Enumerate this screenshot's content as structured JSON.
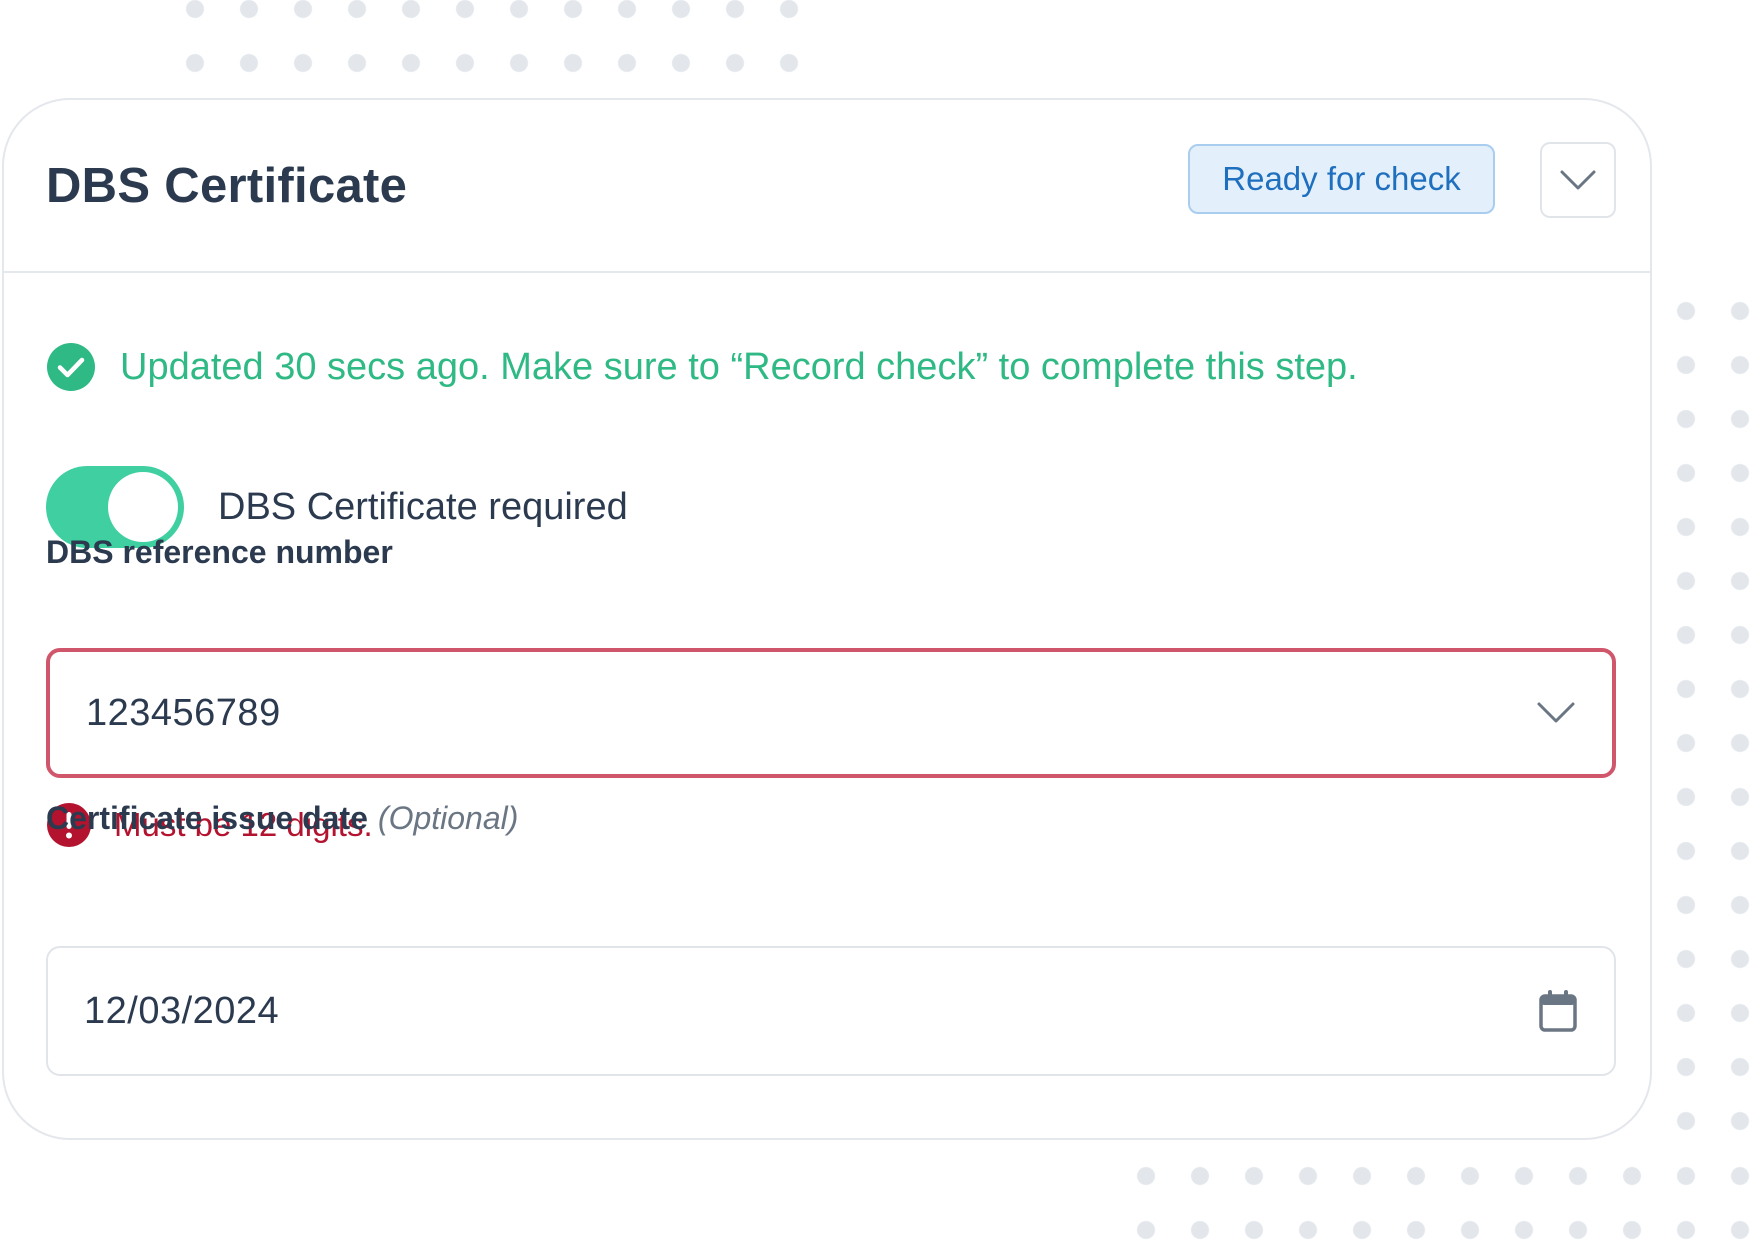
{
  "card": {
    "title": "DBS Certificate",
    "status_badge": "Ready for check"
  },
  "update_notice": {
    "text": "Updated 30 secs ago. Make sure to “Record check” to complete this step."
  },
  "toggle": {
    "label": "DBS Certificate required",
    "checked": true
  },
  "reference_field": {
    "label": "DBS reference number",
    "value": "123456789",
    "error": "Must be 12 digits."
  },
  "issue_date_field": {
    "label": "Certificate issue date",
    "optional_label": "(Optional)",
    "value": "12/03/2024"
  },
  "icons": {
    "collapse": "chevron-down-icon",
    "success": "check-circle-icon",
    "error": "exclamation-circle-icon",
    "dropdown": "chevron-down-icon",
    "calendar": "calendar-icon"
  },
  "colors": {
    "success_green": "#2fb985",
    "toggle_green": "#3fcfa0",
    "badge_blue": "#1f6fbf",
    "badge_bg": "#e3f0fc",
    "error_red": "#b3132e",
    "error_border": "#d0576b",
    "text_dark": "#2b3a4f"
  }
}
